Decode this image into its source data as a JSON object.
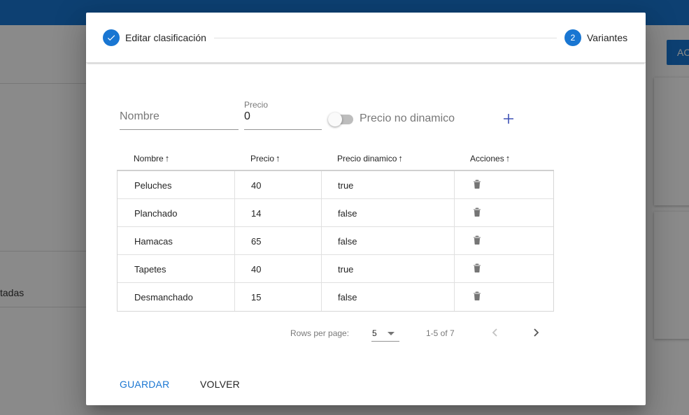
{
  "background": {
    "partial_text": "tadas",
    "button_label": "AC"
  },
  "stepper": {
    "steps": [
      {
        "label": "Editar clasificación",
        "state": "complete",
        "icon": "check-icon"
      },
      {
        "label": "Variantes",
        "number": "2",
        "state": "active"
      }
    ]
  },
  "form": {
    "nombre_placeholder": "Nombre",
    "precio_label": "Precio",
    "precio_value": "0",
    "switch_label": "Precio no dinamico",
    "switch_on": false,
    "add_icon": "plus-icon"
  },
  "table": {
    "columns": [
      "Nombre",
      "Precio",
      "Precio dinamico",
      "Acciones"
    ],
    "sort_icon": "arrow-up-icon",
    "rows": [
      {
        "nombre": "Peluches",
        "precio": "40",
        "dinamico": "true"
      },
      {
        "nombre": "Planchado",
        "precio": "14",
        "dinamico": "false"
      },
      {
        "nombre": "Hamacas",
        "precio": "65",
        "dinamico": "false"
      },
      {
        "nombre": "Tapetes",
        "precio": "40",
        "dinamico": "true"
      },
      {
        "nombre": "Desmanchado",
        "precio": "15",
        "dinamico": "false"
      }
    ],
    "row_action_icon": "trash-icon"
  },
  "pagination": {
    "rows_per_page_label": "Rows per page:",
    "rows_per_page_value": "5",
    "range": "1-5 of 7"
  },
  "actions": {
    "save_label": "GUARDAR",
    "back_label": "VOLVER"
  },
  "colors": {
    "primary": "#1976d2",
    "add_icon": "#3f51b5"
  }
}
